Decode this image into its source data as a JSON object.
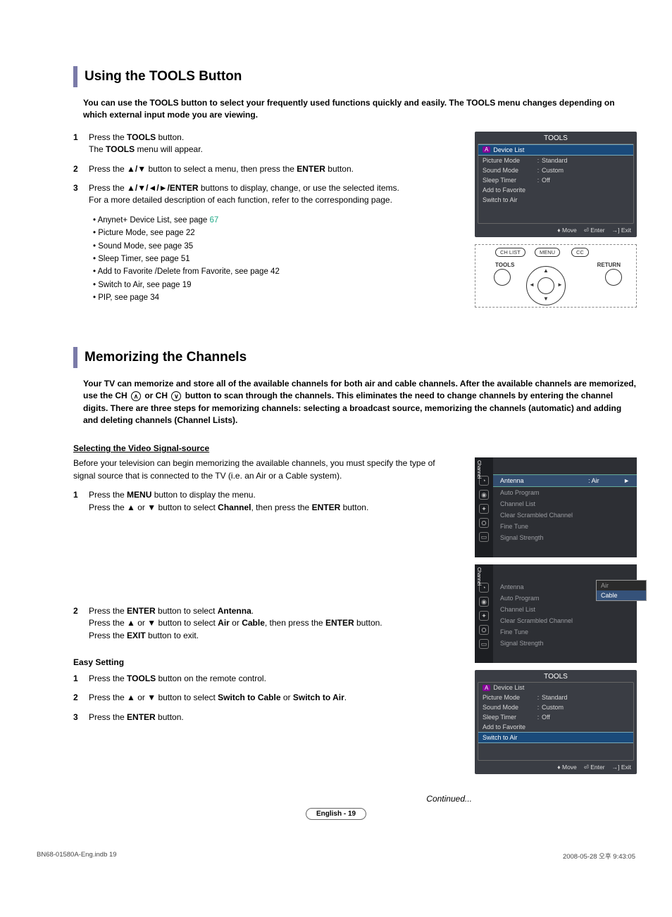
{
  "section1": {
    "title": "Using the TOOLS Button",
    "intro": "You can use the TOOLS button to select your frequently used functions quickly and easily. The TOOLS menu changes depending on which external input mode you are viewing.",
    "steps": [
      {
        "num": "1",
        "pre": "Press the ",
        "b1": "TOOLS",
        "mid": " button.\nThe ",
        "b2": "TOOLS",
        "post": " menu will appear."
      },
      {
        "num": "2",
        "pre": "Press the ",
        "b1": "▲/▼",
        "mid": " button to select a menu, then press the ",
        "b2": "ENTER",
        "post": " button."
      },
      {
        "num": "3",
        "pre": "Press the ",
        "b1": "▲/▼/◄/►/ENTER",
        "mid": " buttons to display, change, or use the selected items.\nFor a more detailed description of each function, refer to the corresponding page.",
        "b2": "",
        "post": ""
      }
    ],
    "bullets": [
      {
        "b": "Anynet+",
        "t": " Device List, see page ",
        "pg": "67"
      },
      {
        "b": "",
        "t": "Picture Mode, see page 22",
        "pg": ""
      },
      {
        "b": "",
        "t": "Sound Mode, see page 35",
        "pg": ""
      },
      {
        "b": "",
        "t": "Sleep Timer, see page 51",
        "pg": ""
      },
      {
        "b": "",
        "t": "Add to Favorite /Delete from Favorite, see page 42",
        "pg": ""
      },
      {
        "b": "",
        "t": "Switch to Air, see page 19",
        "pg": ""
      },
      {
        "b": "",
        "t": "PIP, see page 34",
        "pg": ""
      }
    ]
  },
  "osd_tools": {
    "title": "TOOLS",
    "rows": [
      {
        "k": "Device List",
        "c": "",
        "v": "",
        "badge": true
      },
      {
        "k": "Picture Mode",
        "c": ":",
        "v": "Standard"
      },
      {
        "k": "Sound Mode",
        "c": ":",
        "v": "Custom"
      },
      {
        "k": "Sleep Timer",
        "c": ":",
        "v": "Off"
      },
      {
        "k": "Add to Favorite",
        "c": "",
        "v": ""
      },
      {
        "k": "Switch to Air",
        "c": "",
        "v": ""
      }
    ],
    "foot": {
      "move": "Move",
      "enter": "Enter",
      "exit": "Exit"
    }
  },
  "remote": {
    "chlist": "CH LIST",
    "menu": "MENU",
    "cc": "CC",
    "tools": "TOOLS",
    "return": "RETURN"
  },
  "section2": {
    "title": "Memorizing the Channels",
    "intro_a": "Your TV can memorize and store all of the available channels for both air and cable channels. After the available channels are memorized, use the CH ",
    "intro_b": " or CH ",
    "intro_c": " button to scan through the channels. This eliminates the need to change channels by entering the channel digits. There are three steps for memorizing channels: selecting a broadcast source, memorizing the channels (automatic) and adding and deleting channels (Channel Lists).",
    "sub1_title": "Selecting the Video Signal-source",
    "sub1_para": "Before your television can begin memorizing the available channels, you must specify the type of signal source that is connected to the TV (i.e. an Air or a Cable system).",
    "s1_steps": [
      {
        "num": "1",
        "html": "Press the <b>MENU</b> button to display the menu.<br>Press the ▲ or ▼ button to select <b>Channel</b>, then press the <b>ENTER</b> button."
      },
      {
        "num": "2",
        "html": "Press the <b>ENTER</b> button to select <b>Antenna</b>.<br>Press the ▲ or ▼ button to select <b>Air</b> or <b>Cable</b>, then press the <b>ENTER</b> button.<br>Press the <b>EXIT</b> button to exit."
      }
    ],
    "easy_title": "Easy Setting",
    "easy_steps": [
      {
        "num": "1",
        "html": "Press the <b>TOOLS</b> button on the remote control."
      },
      {
        "num": "2",
        "html": "Press the ▲ or ▼ button to select <b>Switch to Cable</b> or <b>Switch to Air</b>."
      },
      {
        "num": "3",
        "html": "Press the <b>ENTER</b> button."
      }
    ]
  },
  "osd_channel": {
    "side_label": "Channel",
    "rows": [
      {
        "k": "Antenna",
        "v": ": Air",
        "sel": true
      },
      {
        "k": "Auto Program"
      },
      {
        "k": "Channel List"
      },
      {
        "k": "Clear Scrambled Channel"
      },
      {
        "k": "Fine Tune"
      },
      {
        "k": "Signal Strength"
      }
    ]
  },
  "osd_channel2": {
    "side_label": "Channel",
    "rows": [
      {
        "k": "Antenna"
      },
      {
        "k": "Auto Program"
      },
      {
        "k": "Channel List"
      },
      {
        "k": "Clear Scrambled Channel"
      },
      {
        "k": "Fine Tune"
      },
      {
        "k": "Signal Strength"
      }
    ],
    "drop": {
      "opt1": "Air",
      "opt2": "Cable"
    }
  },
  "osd_tools2": {
    "title": "TOOLS",
    "rows": [
      {
        "k": "Device List",
        "c": "",
        "v": "",
        "badge": true
      },
      {
        "k": "Picture Mode",
        "c": ":",
        "v": "Standard"
      },
      {
        "k": "Sound Mode",
        "c": ":",
        "v": "Custom"
      },
      {
        "k": "Sleep Timer",
        "c": ":",
        "v": "Off"
      },
      {
        "k": "Add to Favorite",
        "c": "",
        "v": ""
      },
      {
        "k": "Switch to Air",
        "c": "",
        "v": "",
        "hl": true
      }
    ],
    "foot": {
      "move": "Move",
      "enter": "Enter",
      "exit": "Exit"
    }
  },
  "continued": "Continued...",
  "pagenum": "English - 19",
  "footer": {
    "left": "BN68-01580A-Eng.indb   19",
    "right": "2008-05-28   오후 9:43:05"
  }
}
